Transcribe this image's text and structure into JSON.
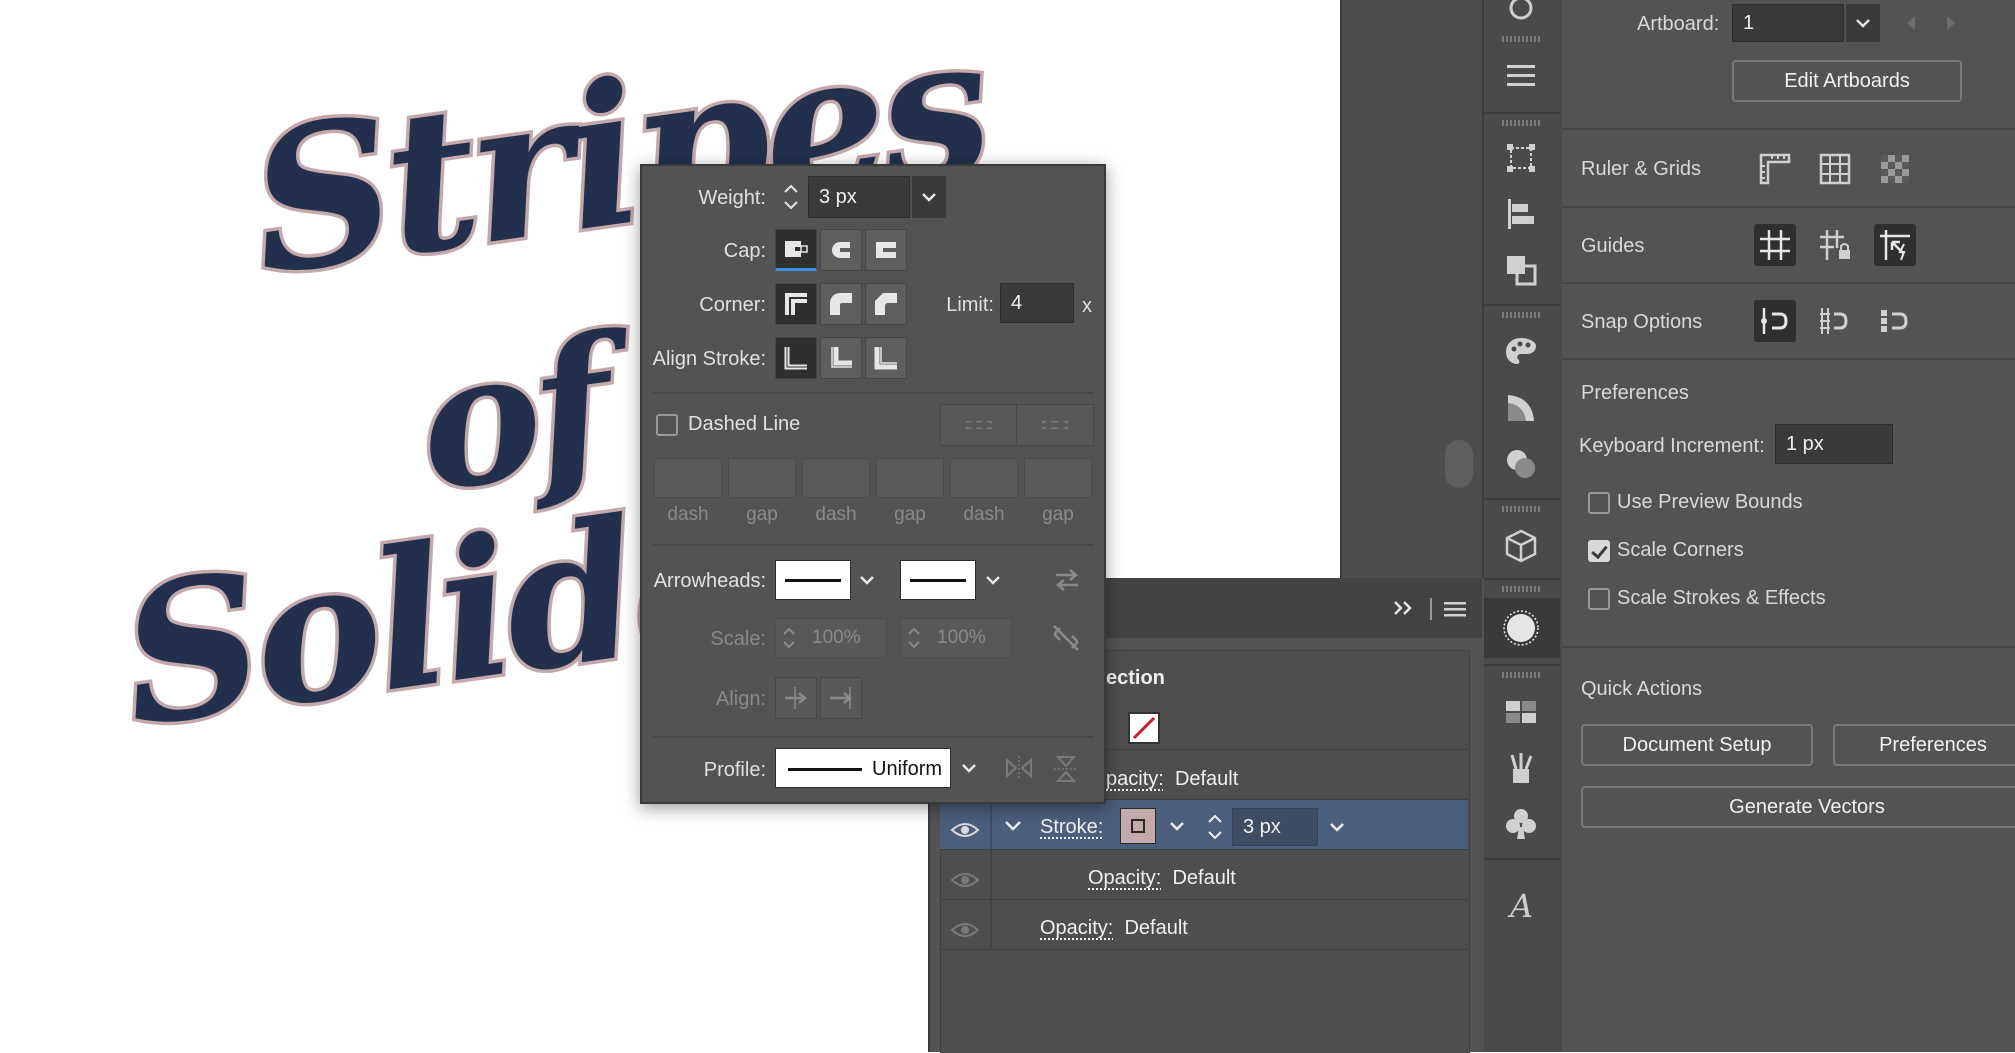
{
  "artwork": {
    "line1": "Stripes",
    "line2": "of",
    "line3": "Solidarity"
  },
  "stroke_panel": {
    "weight": {
      "label": "Weight:",
      "value": "3 px"
    },
    "cap": {
      "label": "Cap:"
    },
    "corner": {
      "label": "Corner:",
      "limit_label": "Limit:",
      "limit_value": "4",
      "limit_unit": "x"
    },
    "align_stroke": {
      "label": "Align Stroke:"
    },
    "dashed_line": {
      "label": "Dashed Line",
      "checked": false
    },
    "dash_labels": [
      "dash",
      "gap",
      "dash",
      "gap",
      "dash",
      "gap"
    ],
    "arrowheads": {
      "label": "Arrowheads:"
    },
    "scale": {
      "label": "Scale:",
      "start": "100%",
      "end": "100%"
    },
    "align": {
      "label": "Align:"
    },
    "profile": {
      "label": "Profile:",
      "value": "Uniform"
    }
  },
  "appearance_panel": {
    "section_title": "ection",
    "rows": [
      {
        "label": "pacity:",
        "value": "Default"
      },
      {
        "label": "Stroke:",
        "value": "3 px",
        "selected": true
      },
      {
        "label": "Opacity:",
        "value": "Default"
      },
      {
        "label": "Opacity:",
        "value": "Default"
      }
    ]
  },
  "properties_panel": {
    "artboard": {
      "label": "Artboard:",
      "value": "1"
    },
    "edit_artboards": "Edit Artboards",
    "ruler_grids": "Ruler & Grids",
    "guides": "Guides",
    "snap_options": "Snap Options",
    "preferences_title": "Preferences",
    "keyboard_increment": {
      "label": "Keyboard Increment:",
      "value": "1 px"
    },
    "use_preview_bounds": {
      "label": "Use Preview Bounds",
      "checked": false
    },
    "scale_corners": {
      "label": "Scale Corners",
      "checked": true
    },
    "scale_strokes": {
      "label": "Scale Strokes & Effects",
      "checked": false
    },
    "quick_actions": "Quick Actions",
    "document_setup": "Document Setup",
    "preferences_btn": "Preferences",
    "generate_vectors": "Generate Vectors"
  },
  "colors": {
    "art_fill": "#22304e",
    "art_outline": "#c4a9ab",
    "panel_bg": "#535353",
    "selection": "#4a5f7c"
  }
}
